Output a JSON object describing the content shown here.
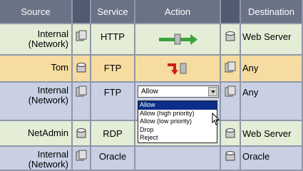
{
  "columns": [
    "Source",
    "Service",
    "Action",
    "Destination"
  ],
  "rows": [
    {
      "source": [
        "Internal",
        "(Network)"
      ],
      "service": "HTTP",
      "action": "allow-arrow",
      "destination": "Web Server"
    },
    {
      "source": [
        "Tom"
      ],
      "service": "FTP",
      "action": "reject-arrow",
      "destination": "Any"
    },
    {
      "source": [
        "Internal",
        "(Network)"
      ],
      "service": "FTP",
      "action": "dropdown",
      "destination": "Any"
    },
    {
      "source": [
        "NetAdmin"
      ],
      "service": "RDP",
      "action": "",
      "destination": "Web Server"
    },
    {
      "source": [
        "Internal",
        "(Network)"
      ],
      "service": "Oracle",
      "action": "",
      "destination": "Oracle"
    }
  ],
  "action_select": {
    "value": "Allow",
    "options": [
      "Allow",
      "Allow (high priority)",
      "Allow (low priority)",
      "Drop",
      "Reject"
    ],
    "highlighted": "Allow"
  },
  "colors": {
    "row_green": "#e4edd6",
    "row_tan": "#f6dca0",
    "row_blue": "#c9d0e4",
    "header": "#6a7286"
  }
}
